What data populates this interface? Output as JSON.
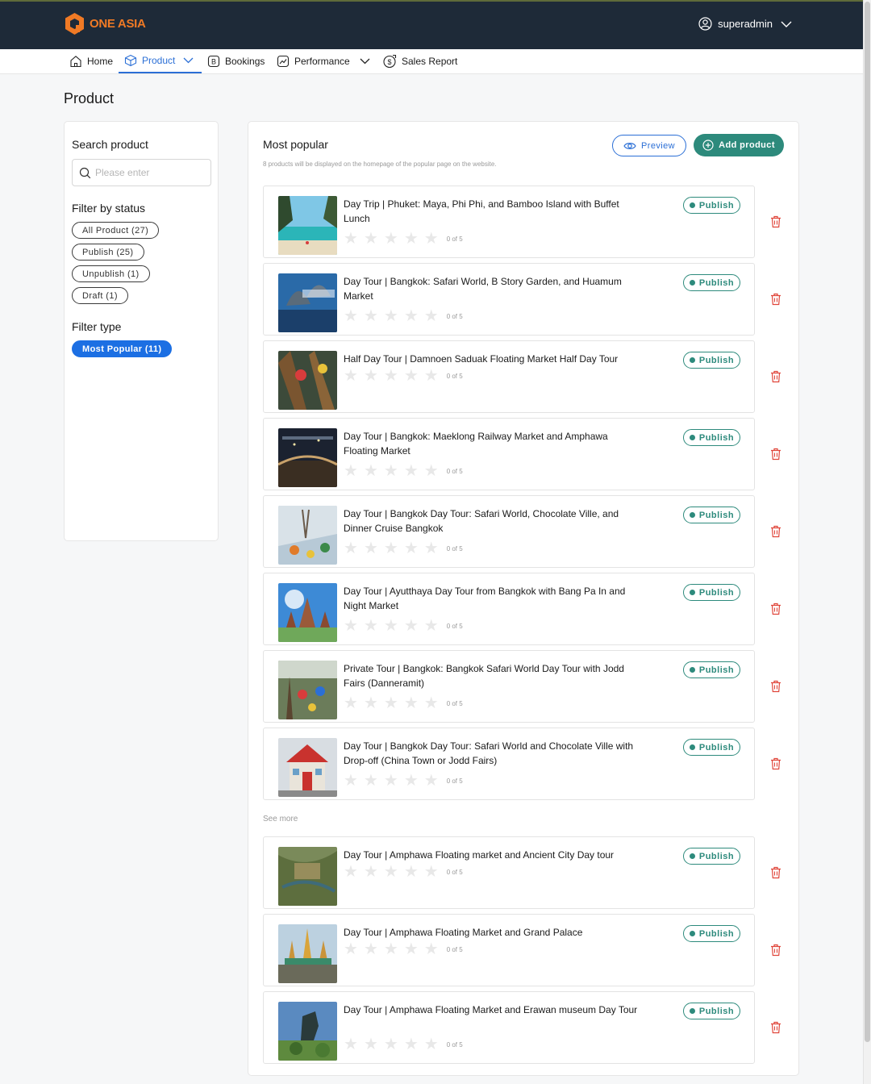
{
  "app": {
    "logo_text": "ONE ASIA"
  },
  "user": {
    "name": "superadmin"
  },
  "nav": [
    {
      "label": "Home",
      "icon": "home-icon"
    },
    {
      "label": "Product",
      "icon": "box-icon",
      "active": true
    },
    {
      "label": "Bookings",
      "icon": "bookings-icon"
    },
    {
      "label": "Performance",
      "icon": "chart-icon"
    },
    {
      "label": "Sales Report",
      "icon": "dollar-icon"
    }
  ],
  "page": {
    "title": "Product"
  },
  "sidebar": {
    "search_heading": "Search product",
    "search_placeholder": "Please enter",
    "status_heading": "Filter by status",
    "status_filters": [
      "All Product (27)",
      "Publish (25)",
      "Unpublish (1)",
      "Draft (1)"
    ],
    "type_heading": "Filter type",
    "type_filters": [
      "Most Popular (11)"
    ]
  },
  "main": {
    "title": "Most popular",
    "description": "8 products will be displayed on the homepage of the popular page on the website.",
    "preview_label": "Preview",
    "add_label": "Add product",
    "see_more": "See more"
  },
  "colors": {
    "header_bg": "#1e2a38",
    "brand": "#f07a25",
    "accent": "#2d8a7c",
    "link": "#2b6fd6",
    "delete": "#e0453a"
  },
  "products": [
    {
      "title": "Day Trip | Phuket: Maya, Phi Phi, and Bamboo Island with Buffet Lunch",
      "status": "Publish",
      "rating": "0 of 5",
      "stars": 0
    },
    {
      "title": "Day Tour | Bangkok: Safari World, B Story Garden, and Huamum Market",
      "status": "Publish",
      "rating": "0 of 5",
      "stars": 0
    },
    {
      "title": "Half Day Tour | Damnoen Saduak Floating Market Half Day Tour",
      "status": "Publish",
      "rating": "0 of 5",
      "stars": 0
    },
    {
      "title": "Day Tour | Bangkok: Maeklong Railway Market and Amphawa Floating Market",
      "status": "Publish",
      "rating": "0 of 5",
      "stars": 0
    },
    {
      "title": "Day Tour | Bangkok Day Tour: Safari World, Chocolate Ville, and Dinner Cruise Bangkok",
      "status": "Publish",
      "rating": "0 of 5",
      "stars": 0
    },
    {
      "title": "Day Tour | Ayutthaya Day Tour from Bangkok with Bang Pa In and Night Market",
      "status": "Publish",
      "rating": "0 of 5",
      "stars": 0
    },
    {
      "title": "Private Tour | Bangkok: Bangkok Safari World Day Tour with Jodd Fairs (Danneramit)",
      "status": "Publish",
      "rating": "0 of 5",
      "stars": 0
    },
    {
      "title": "Day Tour | Bangkok Day Tour: Safari World and Chocolate Ville with Drop-off (China Town or Jodd Fairs)",
      "status": "Publish",
      "rating": "0 of 5",
      "stars": 0
    },
    {
      "title": "Day Tour | Amphawa Floating market and Ancient City Day tour",
      "status": "Publish",
      "rating": "0 of 5",
      "stars": 0
    },
    {
      "title": "Day Tour | Amphawa Floating Market and Grand Palace",
      "status": "Publish",
      "rating": "0 of 5",
      "stars": 0
    },
    {
      "title": "Day Tour | Amphawa Floating Market and Erawan museum Day Tour",
      "status": "Publish",
      "rating": "0 of 5",
      "stars": 0
    }
  ]
}
